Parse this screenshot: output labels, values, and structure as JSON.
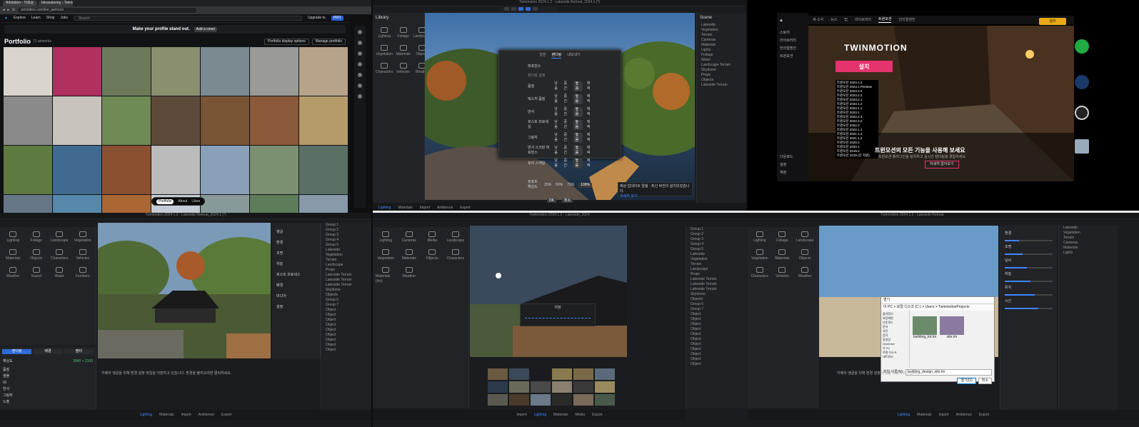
{
  "browser": {
    "tabs": [
      "Artstation - 이희윤",
      "Ideasalaring - TwinMo..."
    ],
    "url": "artstation.com/lee_jaehoon",
    "nav": [
      "Explore",
      "Learn",
      "Shop",
      "Jobs"
    ],
    "search_placeholder": "Search",
    "upgrade": "Upgrade to",
    "upgrade_badge": "PRO",
    "banner_text": "Make your profile stand out.",
    "banner_button": "Add a cover",
    "portfolio_title": "Portfolio",
    "portfolio_count": "71 artworks",
    "display_options": "Portfolio display options",
    "manage": "Manage portfolio",
    "filter_tabs": [
      "Portfolio",
      "About",
      "Likes"
    ],
    "thumb_colors": [
      "#d9d4cc",
      "#b03060",
      "#6c7a5a",
      "#8a8f70",
      "#7a8a90",
      "#9a9a96",
      "#b7a38a",
      "#8a8a8a",
      "#c8c4bc",
      "#6f8a55",
      "#5e4a3a",
      "#7a5535",
      "#8a5a3a",
      "#b59a6a",
      "#5f7a40",
      "#406a90",
      "#8a5030",
      "#bbbbbb",
      "#8aa0b8",
      "#7a9070",
      "#5a7065",
      "#667788",
      "#5588aa",
      "#aa6633",
      "#c5ccd5",
      "#889999",
      "#5d7d5a",
      "#8899aa"
    ]
  },
  "tm_top": {
    "title": "Twinmotion 2024.1.2 - Lakeside Retreat_2024.1 (*)",
    "library_label": "Library",
    "scene_label": "Scene",
    "library_items": [
      "Lighting",
      "Foliage",
      "Landscape",
      "Vegetation",
      "Materials",
      "Objects",
      "Characters",
      "Vehicles",
      "Weather"
    ],
    "scene_items": [
      "Lakeside",
      "Vegetation",
      "Terrain",
      "Cameras",
      "Materials",
      "Lights",
      "Foliage",
      "Water",
      "Landscape Terrain",
      "Skydome",
      "Props",
      "Objects",
      "Lakeside Terrain"
    ],
    "dialog_tabs": [
      "일반",
      "렌더링",
      "내보내기"
    ],
    "dialog_title": "퍼포먼스",
    "dialog_sub": "렌더링 설정",
    "dialog_rows": [
      "품질",
      "텍스처 품질",
      "반사",
      "포스트 프로세싱",
      "그림자",
      "반사 스크린 퍼포먼스",
      "포어 스케일"
    ],
    "dialog_options": [
      "낮음",
      "중간",
      "높음",
      "에픽"
    ],
    "dialog_scale_label": "뷰포트 해상도",
    "dialog_scales": [
      "25%",
      "50%",
      "75%",
      "100%"
    ],
    "dialog_buttons": [
      "OK",
      "취소"
    ],
    "notif_text": "예상 업데이트 알림 - 최신 버전이 설치되었습니다.",
    "notif_link": "자세히 보기",
    "dock": [
      "Lighting",
      "Materials",
      "Import",
      "Ambience",
      "Export"
    ]
  },
  "epic": {
    "nav": [
      "새 소식",
      "뉴스",
      "팁",
      "라이브러리",
      "트윈모션",
      "언리얼엔진"
    ],
    "side": [
      "스토어",
      "라이브러리",
      "언리얼엔진",
      "트윈모션"
    ],
    "side_bottom": [
      "다운로드",
      "설정",
      "계정"
    ],
    "launch_btn": "설치",
    "launch_sub": "트윈모션 2024.1.2",
    "logo": "TWINMOTION",
    "install": "설치",
    "versions": [
      "트윈모션 2024.1.2",
      "트윈모션 2024.1 Preview",
      "트윈모션 2023.2.3",
      "트윈모션 2023.2.2",
      "트윈모션 2023.2.1",
      "트윈모션 2023.1.2",
      "트윈모션 2023.1.1",
      "트윈모션 2023.1",
      "트윈모션 2022.2.3",
      "트윈모션 2022.2.2",
      "트윈모션 2022.2",
      "트윈모션 2022.1.1",
      "트윈모션 2021.1.4",
      "트윈모션 2021.1.2",
      "트윈모션 2020.2",
      "트윈모션 2020.1",
      "트윈모션 2019.2",
      "트윈모션 2019 (단 지원)"
    ],
    "headline": "트윈모션의 모든 기능을 사용해 보세요",
    "subline": "트윈모션 플러그인을 설치하고 실시간 렌더링을 경험하세요",
    "cta": "자세히 알아보기",
    "desktop_icons": [
      "Refresh",
      "Steam",
      "OBS",
      "Recycle"
    ]
  },
  "tm_bl": {
    "title": "Twinmotion 2024.1.2 - Lakeside Retreat_2024.1 (*)",
    "library_items": [
      "Lighting",
      "Foliage",
      "Landscape",
      "Vegetation",
      "Materials",
      "Objects",
      "Characters",
      "Vehicles",
      "Weather",
      "Sound",
      "Water",
      "Furniture"
    ],
    "panel_tabs": [
      "렌더링",
      "배경",
      "필터"
    ],
    "props": [
      "해상도",
      "품질",
      "샘플",
      "GI",
      "반사",
      "그림자",
      "노출"
    ],
    "prop_value": "3840 × 2160",
    "side_menu": [
      "앵글",
      "환경",
      "조명",
      "하늘",
      "포스트 프로세스",
      "배경",
      "미디어",
      "설정"
    ],
    "footer": "카메라 앵글을 위해 환경 설정 파일을 저장하고 있습니다. 환경을 불러오려면 클릭하세요."
  },
  "tm_bm": {
    "title": "Twinmotion 2024.1.2 - Lakeside_2024",
    "library_items": [
      "Lighting",
      "Cameras",
      "Media",
      "Landscape",
      "Vegetation",
      "Materials",
      "Objects",
      "Characters",
      "Materials (Art)",
      "Weather"
    ],
    "progress_title": "저장",
    "dock": [
      "Import",
      "Lighting",
      "Materials",
      "Media",
      "Export"
    ]
  },
  "tm_br": {
    "title": "Twinmotion 2024.1.2 - Lakeside Retreat",
    "scene_items": [
      "Group 1",
      "Group 2",
      "Group 3",
      "Group 4",
      "Group 5",
      "Lakeside",
      "Vegetation",
      "Terrain",
      "Landscape",
      "Props",
      "Lakeside Terrain",
      "Lakeside Terrain",
      "Lakeside Terrain",
      "Skydome",
      "Objects",
      "Group 6",
      "Group 7",
      "Object",
      "Object",
      "Object",
      "Object",
      "Object",
      "Object",
      "Object",
      "Object",
      "Object",
      "Object",
      "Object"
    ],
    "properties": [
      "환경",
      "조명",
      "날씨",
      "하늘",
      "위치",
      "시간"
    ],
    "file_dialog": {
      "title": "열기",
      "path": "이 PC > 로컬 디스크 (C:) > Users > TwinmotionProjects",
      "tree": [
        "즐겨찾기",
        "바탕화면",
        "다운로드",
        "문서",
        "사진",
        "음악",
        "동영상",
        "OneDrive",
        "이 PC",
        "로컬 디스크",
        "네트워크"
      ],
      "files": [
        "building_lot.tm",
        "site.tm"
      ],
      "filename_label": "파일 이름(N):",
      "filename": "building_design_site.tm",
      "buttons": [
        "열기(O)",
        "취소"
      ]
    },
    "footer": "카메라 앵글을 위해 환경 설정 파일을 저장하고 있습니다."
  }
}
